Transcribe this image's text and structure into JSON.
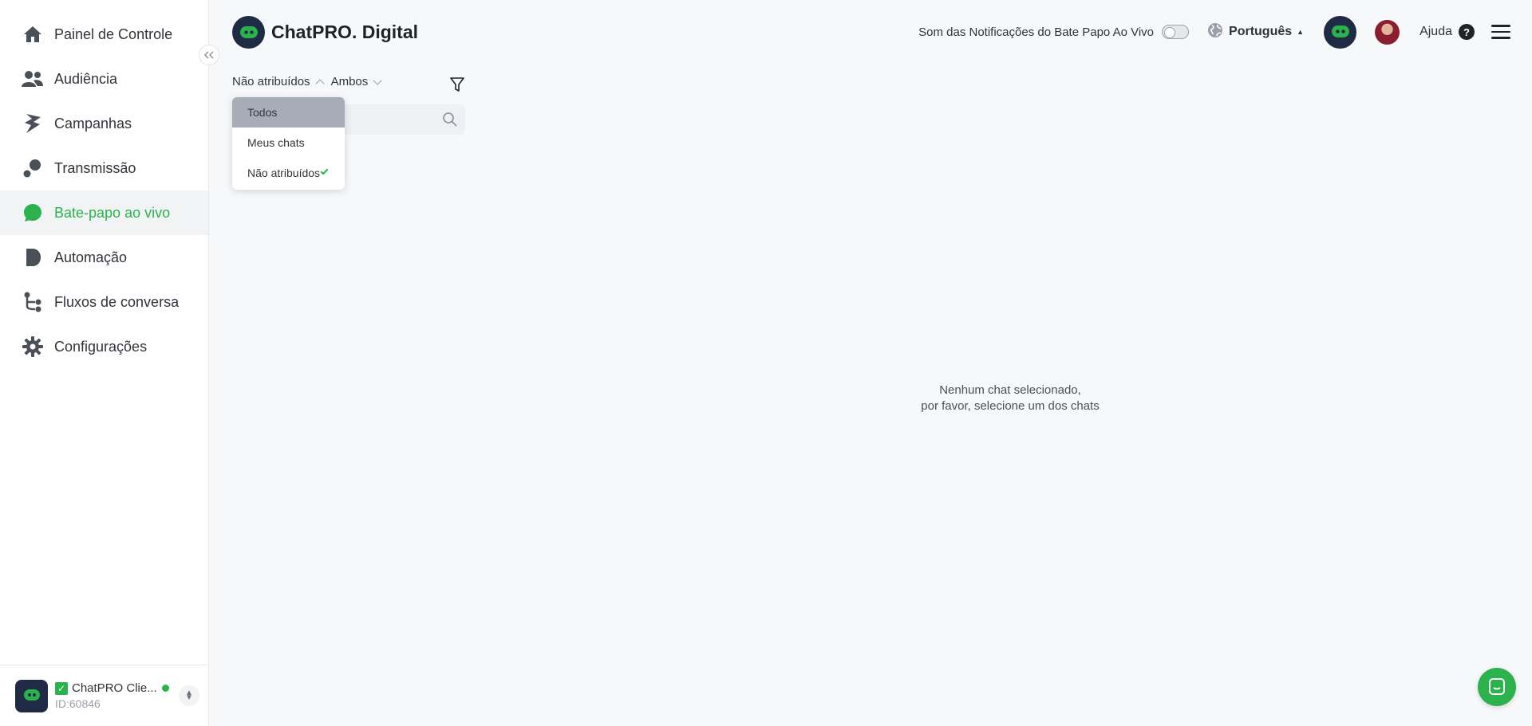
{
  "sidebar": {
    "items": [
      {
        "label": "Painel de Controle",
        "icon": "home-icon"
      },
      {
        "label": "Audiência",
        "icon": "users-icon"
      },
      {
        "label": "Campanhas",
        "icon": "campaigns-icon"
      },
      {
        "label": "Transmissão",
        "icon": "broadcast-icon"
      },
      {
        "label": "Bate-papo ao vivo",
        "icon": "chat-bubble-icon",
        "active": true
      },
      {
        "label": "Automação",
        "icon": "automation-icon"
      },
      {
        "label": "Fluxos de conversa",
        "icon": "flows-icon"
      },
      {
        "label": "Configurações",
        "icon": "gear-icon"
      }
    ],
    "account": {
      "name": "ChatPRO Clie...",
      "id": "ID:60846",
      "status_color": "#2bb24c"
    }
  },
  "header": {
    "brand": "ChatPRO. Digital",
    "notifications_label": "Som das Notificações do Bate Papo Ao Vivo",
    "notifications_on": false,
    "language": "Português",
    "help": "Ajuda"
  },
  "filters": {
    "assignment": "Não atribuídos",
    "channel": "Ambos"
  },
  "dropdown": {
    "items": [
      "Todos",
      "Meus chats",
      "Não atribuídos"
    ],
    "hovered": "Todos",
    "selected": "Não atribuídos"
  },
  "main": {
    "empty_line1": "Nenhum chat selecionado,",
    "empty_line2": "por favor, selecione um dos chats"
  },
  "colors": {
    "accent": "#2bb24c",
    "brand_dark": "#1f2a44"
  }
}
